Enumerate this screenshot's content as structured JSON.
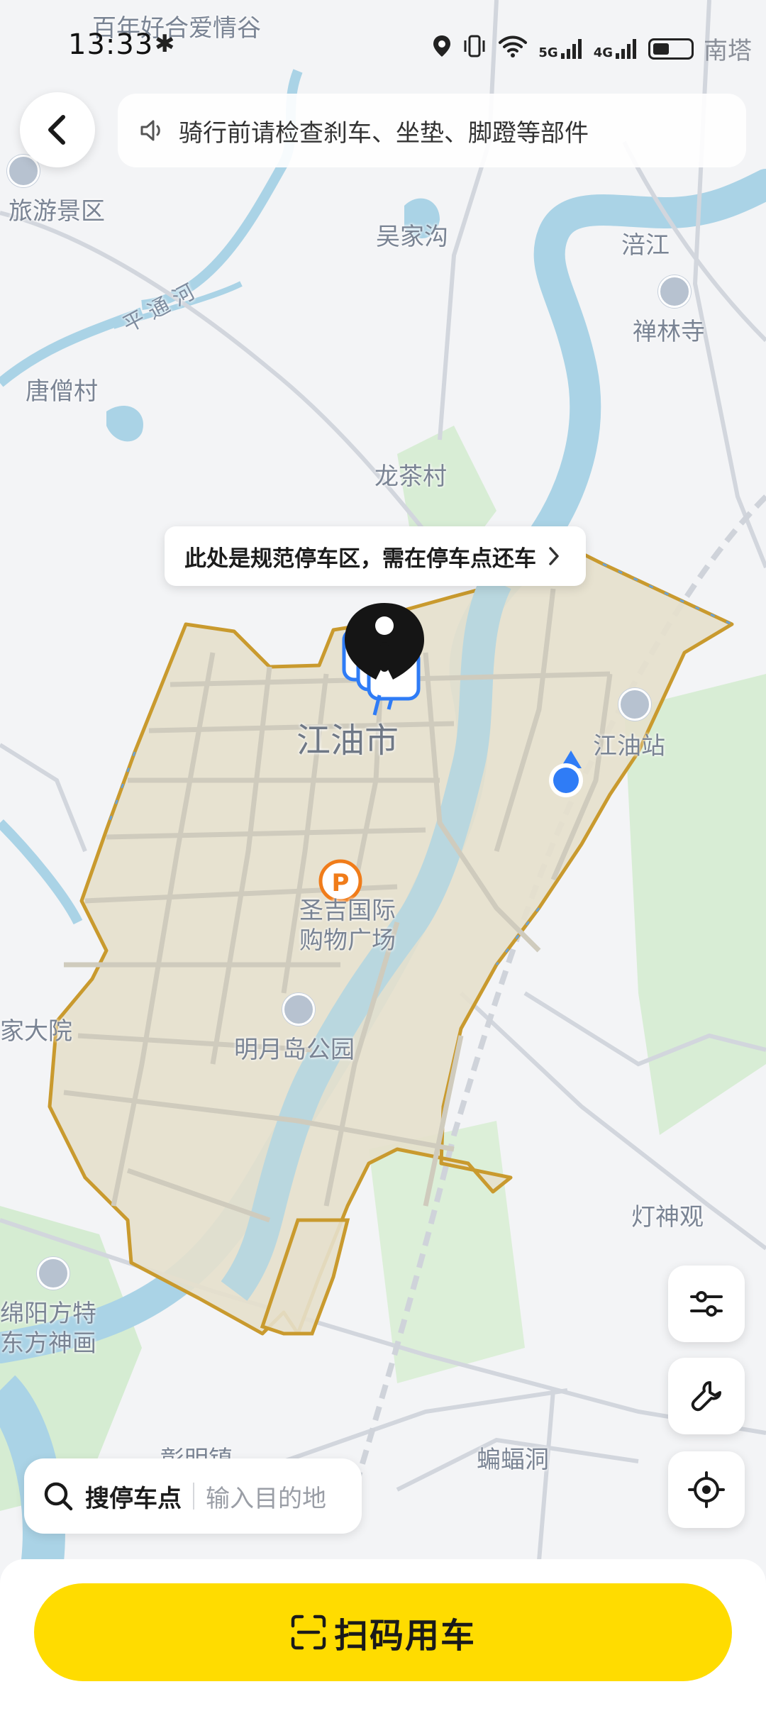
{
  "status_bar": {
    "time": "13:33",
    "network_5g": "5G",
    "network_4g": "4G",
    "trailing_text": "南塔"
  },
  "notice": {
    "text": "骑行前请检查刹车、坐垫、脚蹬等部件",
    "icon": "speaker-icon"
  },
  "tooltip": {
    "text": "此处是规范停车区，需在停车点还车"
  },
  "map_labels": {
    "top_cut": "百年好合爱情谷",
    "scenic": "旅游景区",
    "wujiagou": "吴家沟",
    "fujiang": "涪江",
    "chanlinsi": "禅林寺",
    "road": "平 通 河",
    "tangsengcun": "唐僧村",
    "longchacun": "龙茶村",
    "city": "江油市",
    "station": "江油站",
    "mall_line1": "圣吉国际",
    "mall_line2": "购物广场",
    "park": "明月岛公园",
    "dayuan": "家大院",
    "dengshenguan": "灯神观",
    "mianyang_line1": "绵阳方特",
    "mianyang_line2": "东方神画",
    "bianfudong": "蝙蝠洞",
    "zhangmingzhen": "彰明镇"
  },
  "search": {
    "label": "搜停车点",
    "placeholder": "输入目的地"
  },
  "primary_action": {
    "label": "扫码用车"
  },
  "colors": {
    "accent_yellow": "#ffdc00",
    "zone_border": "#c99a2e",
    "zone_fill": "#e6e0cc",
    "river": "#aad3e6",
    "location_blue": "#2f7cf6"
  }
}
